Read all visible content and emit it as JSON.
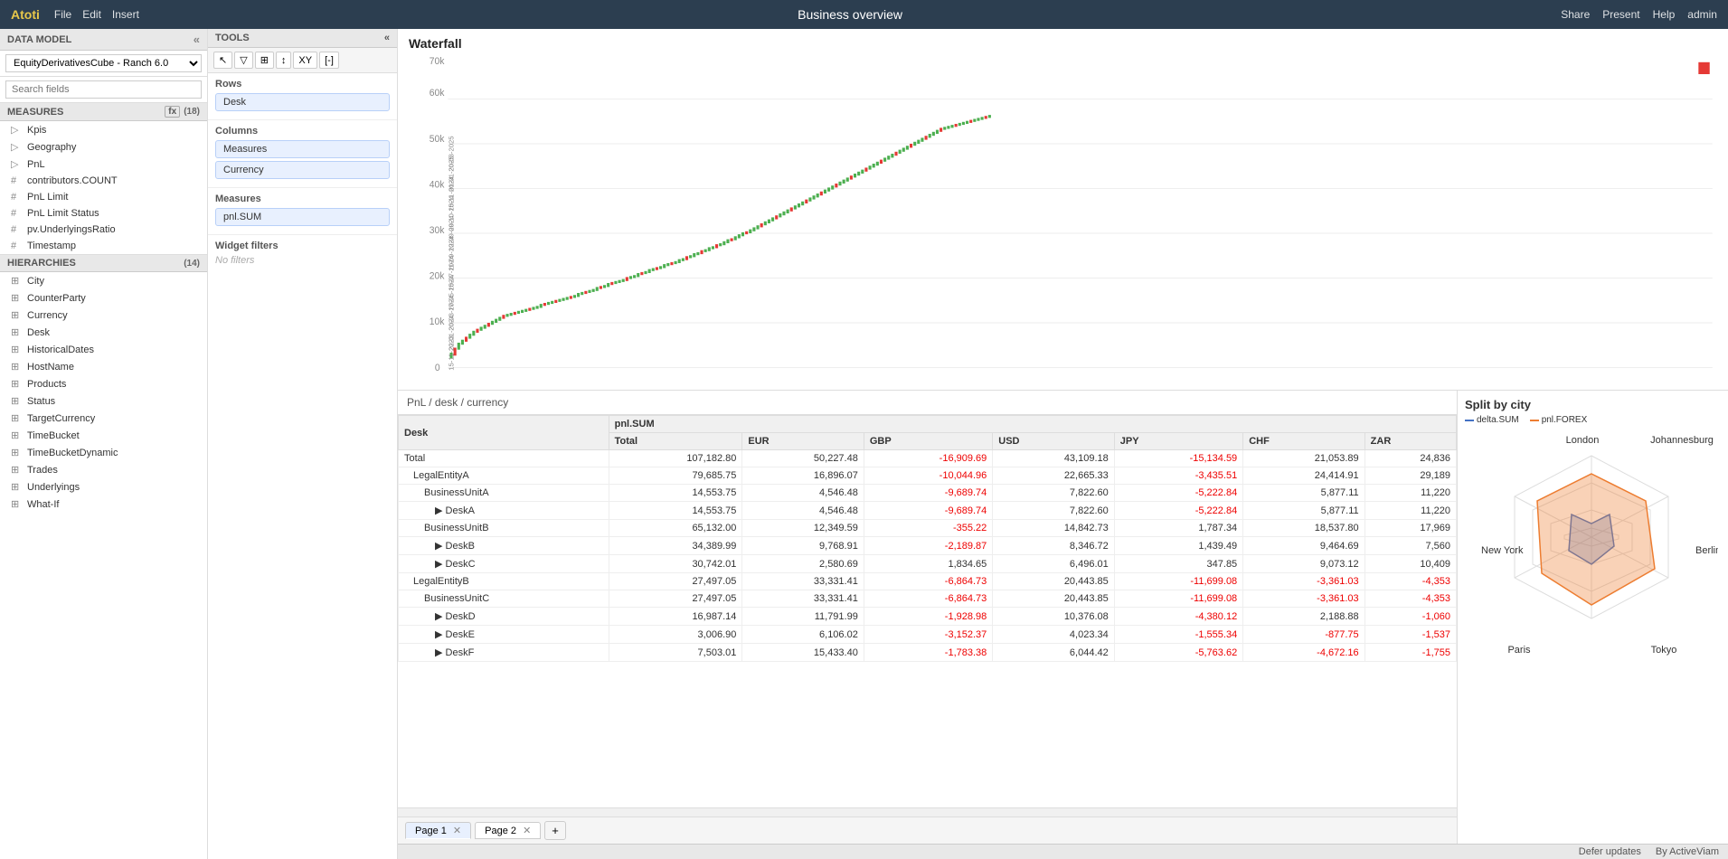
{
  "app": {
    "brand": "Atoti",
    "menu": [
      "File",
      "Edit",
      "Insert"
    ],
    "title": "Business overview",
    "nav": [
      "Share",
      "Present",
      "Help",
      "admin"
    ]
  },
  "left_panel": {
    "data_model_label": "DATA MODEL",
    "cube_name": "EquityDerivativesCube - Ranch 6.0",
    "search_placeholder": "Search fields",
    "measures_label": "MEASURES",
    "measures_fx": "fx",
    "measures_count": "(18)",
    "tree": [
      {
        "type": "folder",
        "label": "Kpis"
      },
      {
        "type": "folder",
        "label": "Geography"
      },
      {
        "type": "folder",
        "label": "PnL"
      },
      {
        "type": "hash",
        "label": "contributors.COUNT"
      },
      {
        "type": "hash",
        "label": "PnL Limit"
      },
      {
        "type": "hash",
        "label": "PnL Limit Status"
      },
      {
        "type": "hash",
        "label": "pv.UnderlyingsRatio"
      },
      {
        "type": "hash",
        "label": "Timestamp"
      }
    ],
    "hierarchies_label": "HIERARCHIES",
    "hierarchies_count": "(14)",
    "hierarchies": [
      "City",
      "CounterParty",
      "Currency",
      "Desk",
      "HistoricalDates",
      "HostName",
      "Products",
      "Status",
      "TargetCurrency",
      "TimeBucket",
      "TimeBucketDynamic",
      "Trades",
      "Underlyings",
      "What-If"
    ]
  },
  "tools_panel": {
    "label": "TOOLS",
    "toolbar_buttons": [
      "↖",
      "▽",
      "⊞",
      "↕",
      "XY",
      "[-]"
    ],
    "rows_label": "Rows",
    "rows_items": [
      "Desk"
    ],
    "columns_label": "Columns",
    "columns_items": [
      "Measures",
      "Currency"
    ],
    "measures_label": "Measures",
    "measures_items": [
      "pnl.SUM"
    ],
    "widget_filters_label": "Widget filters",
    "no_filters": "No filters"
  },
  "chart": {
    "title": "Waterfall",
    "y_labels": [
      "0",
      "10k",
      "20k",
      "30k",
      "40k",
      "50k",
      "60k",
      "70k"
    ]
  },
  "table": {
    "title": "PnL / desk / currency",
    "headers": [
      "Desk",
      "pnl.SUM",
      "",
      "",
      "",
      "",
      "",
      ""
    ],
    "sub_headers": [
      "",
      "Total",
      "EUR",
      "GBP",
      "USD",
      "JPY",
      "CHF",
      "ZAR"
    ],
    "rows": [
      {
        "indent": 0,
        "label": "Total",
        "total": "107,182.80",
        "eur": "50,227.48",
        "gbp": "-16,909.69",
        "usd": "43,109.18",
        "jpy": "-15,134.59",
        "chf": "21,053.89",
        "zar": "24,836",
        "neg_gbp": true,
        "neg_jpy": true
      },
      {
        "indent": 1,
        "label": "LegalEntityA",
        "total": "79,685.75",
        "eur": "16,896.07",
        "gbp": "-10,044.96",
        "usd": "22,665.33",
        "jpy": "-3,435.51",
        "chf": "24,414.91",
        "zar": "29,189",
        "neg_gbp": true,
        "neg_jpy": true
      },
      {
        "indent": 2,
        "label": "BusinessUnitA",
        "total": "14,553.75",
        "eur": "4,546.48",
        "gbp": "-9,689.74",
        "usd": "7,822.60",
        "jpy": "-5,222.84",
        "chf": "5,877.11",
        "zar": "11,220",
        "neg_gbp": true,
        "neg_jpy": true
      },
      {
        "indent": 3,
        "label": "▶ DeskA",
        "total": "14,553.75",
        "eur": "4,546.48",
        "gbp": "-9,689.74",
        "usd": "7,822.60",
        "jpy": "-5,222.84",
        "chf": "5,877.11",
        "zar": "11,220",
        "neg_gbp": true,
        "neg_jpy": true
      },
      {
        "indent": 2,
        "label": "BusinessUnitB",
        "total": "65,132.00",
        "eur": "12,349.59",
        "gbp": "-355.22",
        "usd": "14,842.73",
        "jpy": "1,787.34",
        "chf": "18,537.80",
        "zar": "17,969",
        "neg_gbp": true
      },
      {
        "indent": 3,
        "label": "▶ DeskB",
        "total": "34,389.99",
        "eur": "9,768.91",
        "gbp": "-2,189.87",
        "usd": "8,346.72",
        "jpy": "1,439.49",
        "chf": "9,464.69",
        "zar": "7,560",
        "neg_gbp": true
      },
      {
        "indent": 3,
        "label": "▶ DeskC",
        "total": "30,742.01",
        "eur": "2,580.69",
        "gbp": "1,834.65",
        "usd": "6,496.01",
        "jpy": "347.85",
        "chf": "9,073.12",
        "zar": "10,409"
      },
      {
        "indent": 1,
        "label": "LegalEntityB",
        "total": "27,497.05",
        "eur": "33,331.41",
        "gbp": "-6,864.73",
        "usd": "20,443.85",
        "jpy": "-11,699.08",
        "chf": "-3,361.03",
        "zar": "-4,353",
        "neg_gbp": true,
        "neg_jpy": true,
        "neg_chf": true,
        "neg_zar": true
      },
      {
        "indent": 2,
        "label": "BusinessUnitC",
        "total": "27,497.05",
        "eur": "33,331.41",
        "gbp": "-6,864.73",
        "usd": "20,443.85",
        "jpy": "-11,699.08",
        "chf": "-3,361.03",
        "zar": "-4,353",
        "neg_gbp": true,
        "neg_jpy": true,
        "neg_chf": true,
        "neg_zar": true
      },
      {
        "indent": 3,
        "label": "▶ DeskD",
        "total": "16,987.14",
        "eur": "11,791.99",
        "gbp": "-1,928.98",
        "usd": "10,376.08",
        "jpy": "-4,380.12",
        "chf": "2,188.88",
        "zar": "-1,060",
        "neg_gbp": true,
        "neg_jpy": true,
        "neg_zar": true
      },
      {
        "indent": 3,
        "label": "▶ DeskE",
        "total": "3,006.90",
        "eur": "6,106.02",
        "gbp": "-3,152.37",
        "usd": "4,023.34",
        "jpy": "-1,555.34",
        "chf": "-877.75",
        "zar": "-1,537",
        "neg_gbp": true,
        "neg_jpy": true,
        "neg_chf": true,
        "neg_zar": true
      },
      {
        "indent": 3,
        "label": "▶ DeskF",
        "total": "7,503.01",
        "eur": "15,433.40",
        "gbp": "-1,783.38",
        "usd": "6,044.42",
        "jpy": "-5,763.62",
        "chf": "-4,672.16",
        "zar": "-1,755",
        "neg_gbp": true,
        "neg_jpy": true,
        "neg_chf": true,
        "neg_zar": true
      }
    ],
    "pages": [
      "Page 1",
      "Page 2"
    ]
  },
  "radar": {
    "title": "Split by city",
    "legend": [
      {
        "label": "delta.SUM",
        "color": "#4472c4"
      },
      {
        "label": "pnl.FOREX",
        "color": "#ed7d31"
      }
    ],
    "cities": [
      "London",
      "Johannesburg",
      "Berlin",
      "Tokyo",
      "Paris",
      "New York"
    ]
  },
  "status_bar": {
    "defer_updates": "Defer updates",
    "by": "By ActiveViam"
  }
}
